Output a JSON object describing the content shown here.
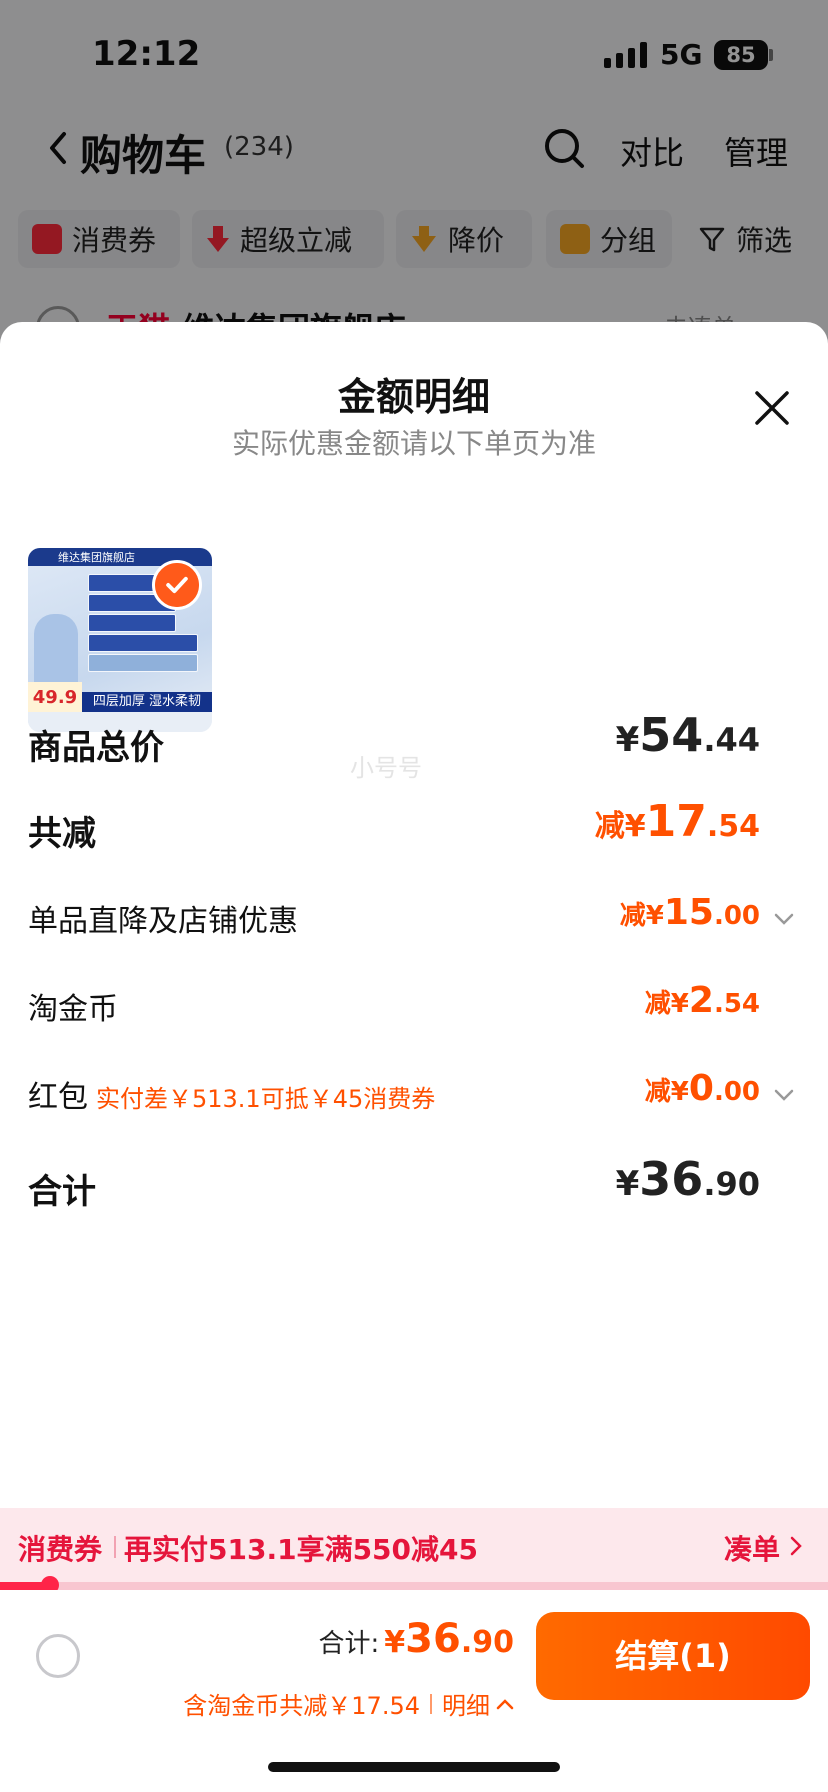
{
  "status_bar": {
    "time": "12:12",
    "network": "5G",
    "battery": "85"
  },
  "nav": {
    "title": "购物车",
    "count": "(234)",
    "compare": "对比",
    "manage": "管理"
  },
  "chips": {
    "coupon": "消费券",
    "super_discount": "超级立减",
    "price_drop": "降价",
    "group": "分组",
    "filter": "筛选"
  },
  "store": {
    "badge": "天猫",
    "name": "维达集团旗舰店",
    "link": "去凑单"
  },
  "sheet": {
    "title": "金额明细",
    "subtitle": "实际优惠金额请以下单页为准",
    "thumbnail": {
      "shop_label": "维达集团旗舰店",
      "price_tag": "49.9",
      "band_text": "四层加厚 湿水柔韧"
    },
    "watermark": "小号号",
    "rows": {
      "goods_total": {
        "label": "商品总价",
        "currency": "¥",
        "int": "54",
        "dec": ".44"
      },
      "total_discount": {
        "label": "共减",
        "prefix": "减¥",
        "int": "17",
        "dec": ".54"
      },
      "item_discount": {
        "label": "单品直降及店铺优惠",
        "prefix": "减¥",
        "int": "15",
        "dec": ".00"
      },
      "gold_coin": {
        "label": "淘金币",
        "prefix": "减¥",
        "int": "2",
        "dec": ".54"
      },
      "red_packet": {
        "label": "红包",
        "hint": "实付差￥513.1可抵￥45消费券",
        "prefix": "减¥",
        "int": "0",
        "dec": ".00"
      },
      "grand_total": {
        "label": "合计",
        "currency": "¥",
        "int": "36",
        "dec": ".90"
      }
    }
  },
  "coupon_strip": {
    "label": "消费券",
    "text": "再实付513.1享满550减45",
    "link": "凑单",
    "progress": 0.06
  },
  "checkout": {
    "total_label": "合计:",
    "total_currency": "¥",
    "total_int": "36",
    "total_dec": ".90",
    "savings_text": "含淘金币共减￥17.54",
    "detail_link": "明细",
    "button_label": "结算(1)"
  },
  "colors": {
    "accent": "#ff5000",
    "coupon_red": "#e5153b",
    "overlay": "rgba(0,0,0,0.42)"
  }
}
